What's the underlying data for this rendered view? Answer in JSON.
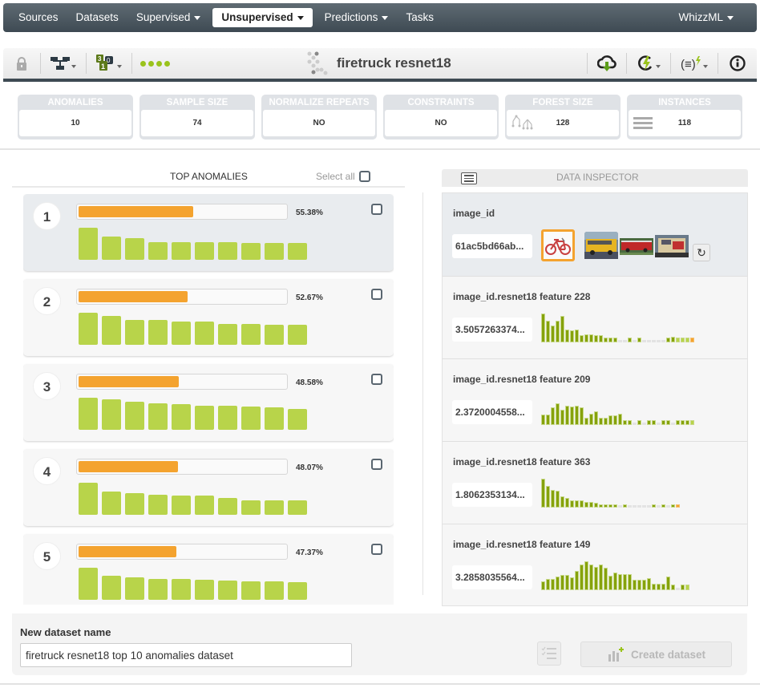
{
  "nav": {
    "items": [
      {
        "label": "Sources",
        "dropdown": false,
        "active": false
      },
      {
        "label": "Datasets",
        "dropdown": false,
        "active": false
      },
      {
        "label": "Supervised",
        "dropdown": true,
        "active": false
      },
      {
        "label": "Unsupervised",
        "dropdown": true,
        "active": true
      },
      {
        "label": "Predictions",
        "dropdown": true,
        "active": false
      },
      {
        "label": "Tasks",
        "dropdown": false,
        "active": false
      }
    ],
    "right": {
      "label": "WhizzML",
      "dropdown": true
    }
  },
  "toolbar": {
    "title": "firetruck resnet18",
    "left_icons": [
      "lock-icon",
      "model-tree-icon",
      "evaluation-counter-icon",
      "status-dots-icon"
    ],
    "counter_badges": [
      "3",
      "0",
      "1"
    ],
    "right_icons": [
      "download-cloud-icon",
      "batch-score-icon",
      "formula-icon",
      "info-icon"
    ],
    "accent_color": "#9ac31c"
  },
  "summary": [
    {
      "label": "ANOMALIES",
      "value": "10"
    },
    {
      "label": "SAMPLE SIZE",
      "value": "74"
    },
    {
      "label": "NORMALIZE REPEATS",
      "value": "NO"
    },
    {
      "label": "CONSTRAINTS",
      "value": "NO"
    },
    {
      "label": "FOREST SIZE",
      "value": "128",
      "icon": "forest-icon"
    },
    {
      "label": "INSTANCES",
      "value": "118",
      "icon": "rows-icon"
    }
  ],
  "anomalies_panel": {
    "title": "TOP ANOMALIES",
    "select_all": "Select all",
    "items": [
      {
        "rank": "1",
        "score": "55.38%",
        "score_frac": 0.5538,
        "selected": true,
        "importances": [
          1.0,
          0.72,
          0.68,
          0.55,
          0.55,
          0.55,
          0.55,
          0.53,
          0.53,
          0.52
        ]
      },
      {
        "rank": "2",
        "score": "52.67%",
        "score_frac": 0.5267,
        "selected": false,
        "importances": [
          1.0,
          0.9,
          0.78,
          0.78,
          0.73,
          0.73,
          0.66,
          0.64,
          0.62,
          0.62
        ]
      },
      {
        "rank": "3",
        "score": "48.58%",
        "score_frac": 0.4858,
        "selected": false,
        "importances": [
          1.0,
          0.95,
          0.88,
          0.83,
          0.8,
          0.75,
          0.75,
          0.73,
          0.71,
          0.65
        ]
      },
      {
        "rank": "4",
        "score": "48.07%",
        "score_frac": 0.4807,
        "selected": false,
        "importances": [
          1.0,
          0.72,
          0.67,
          0.63,
          0.6,
          0.59,
          0.53,
          0.45,
          0.45,
          0.44
        ]
      },
      {
        "rank": "5",
        "score": "47.37%",
        "score_frac": 0.4737,
        "selected": false,
        "importances": [
          1.0,
          0.76,
          0.71,
          0.64,
          0.64,
          0.62,
          0.59,
          0.57,
          0.57,
          0.54
        ]
      }
    ]
  },
  "inspector": {
    "title": "DATA INSPECTOR",
    "image_field": {
      "name": "image_id",
      "value": "61ac5bd66ab...",
      "thumbnails": [
        "bicycle",
        "school-bus",
        "fire-truck-side",
        "fire-truck-front"
      ],
      "selected_thumbnail": "bicycle"
    },
    "features": [
      {
        "name": "image_id.resnet18 feature 228",
        "value": "3.5057263374...",
        "hist": [
          1.0,
          0.76,
          0.58,
          0.76,
          0.92,
          0.44,
          0.42,
          0.44,
          0.24,
          0.28,
          0.28,
          0.26,
          0.26,
          0.16,
          0.16,
          0.16,
          0.08,
          0.08,
          0.16,
          0.08,
          0.16,
          0.08,
          0.08,
          0.08,
          0.08,
          0.08,
          0.16,
          0.2,
          0.16,
          0.16,
          0.16,
          0.16
        ],
        "hist_state": [
          "d",
          "d",
          "d",
          "d",
          "d",
          "d",
          "d",
          "d",
          "d",
          "d",
          "d",
          "d",
          "d",
          "d",
          "d",
          "d",
          "g",
          "g",
          "d",
          "g",
          "d",
          "g",
          "g",
          "g",
          "g",
          "g",
          "d",
          "d",
          "l",
          "l",
          "l",
          "o"
        ]
      },
      {
        "name": "image_id.resnet18 feature 209",
        "value": "2.3720004558...",
        "hist": [
          0.36,
          0.36,
          0.6,
          0.76,
          0.52,
          0.68,
          0.64,
          0.68,
          0.6,
          0.26,
          0.4,
          0.46,
          0.24,
          0.24,
          0.32,
          0.32,
          0.4,
          0.16,
          0.16,
          0.06,
          0.16,
          0.06,
          0.16,
          0.16,
          0.06,
          0.16,
          0.16,
          0.06,
          0.16,
          0.16,
          0.16,
          0.16
        ],
        "hist_state": [
          "d",
          "d",
          "d",
          "d",
          "d",
          "d",
          "d",
          "d",
          "d",
          "d",
          "d",
          "d",
          "d",
          "d",
          "d",
          "d",
          "d",
          "d",
          "d",
          "g",
          "d",
          "g",
          "d",
          "d",
          "g",
          "d",
          "d",
          "g",
          "d",
          "d",
          "d",
          "l"
        ]
      },
      {
        "name": "image_id.resnet18 feature 363",
        "value": "1.8062353134...",
        "hist": [
          1.0,
          0.76,
          0.62,
          0.58,
          0.4,
          0.34,
          0.26,
          0.26,
          0.26,
          0.2,
          0.2,
          0.16,
          0.12,
          0.12,
          0.12,
          0.12,
          0.06,
          0.12,
          0.06,
          0.06,
          0.06,
          0.06,
          0.06,
          0.12,
          0.06,
          0.12,
          0.06,
          0.12,
          0.12
        ],
        "hist_state": [
          "d",
          "d",
          "d",
          "d",
          "d",
          "d",
          "d",
          "d",
          "d",
          "d",
          "d",
          "d",
          "d",
          "d",
          "d",
          "d",
          "g",
          "d",
          "g",
          "g",
          "g",
          "g",
          "g",
          "d",
          "g",
          "d",
          "g",
          "d",
          "o"
        ]
      },
      {
        "name": "image_id.resnet18 feature 149",
        "value": "3.2858035564...",
        "hist": [
          0.3,
          0.38,
          0.38,
          0.48,
          0.52,
          0.52,
          0.44,
          0.66,
          0.88,
          1.0,
          0.88,
          0.8,
          0.88,
          0.78,
          0.5,
          0.6,
          0.56,
          0.56,
          0.56,
          0.36,
          0.36,
          0.36,
          0.42,
          0.22,
          0.22,
          0.22,
          0.48,
          0.2,
          0.06,
          0.2,
          0.2
        ],
        "hist_state": [
          "d",
          "d",
          "d",
          "d",
          "d",
          "d",
          "d",
          "d",
          "d",
          "d",
          "d",
          "d",
          "d",
          "d",
          "d",
          "d",
          "d",
          "d",
          "d",
          "d",
          "d",
          "d",
          "d",
          "d",
          "d",
          "d",
          "d",
          "d",
          "g",
          "d",
          "l"
        ]
      }
    ],
    "hist_colors": {
      "d": "#86a20c",
      "g": "#e3e3e3",
      "l": "#b8d44a",
      "o": "#f4a32f"
    }
  },
  "footer": {
    "label": "New dataset name",
    "input_value": "firetruck resnet18 top 10 anomalies dataset",
    "create_label": "Create dataset"
  }
}
